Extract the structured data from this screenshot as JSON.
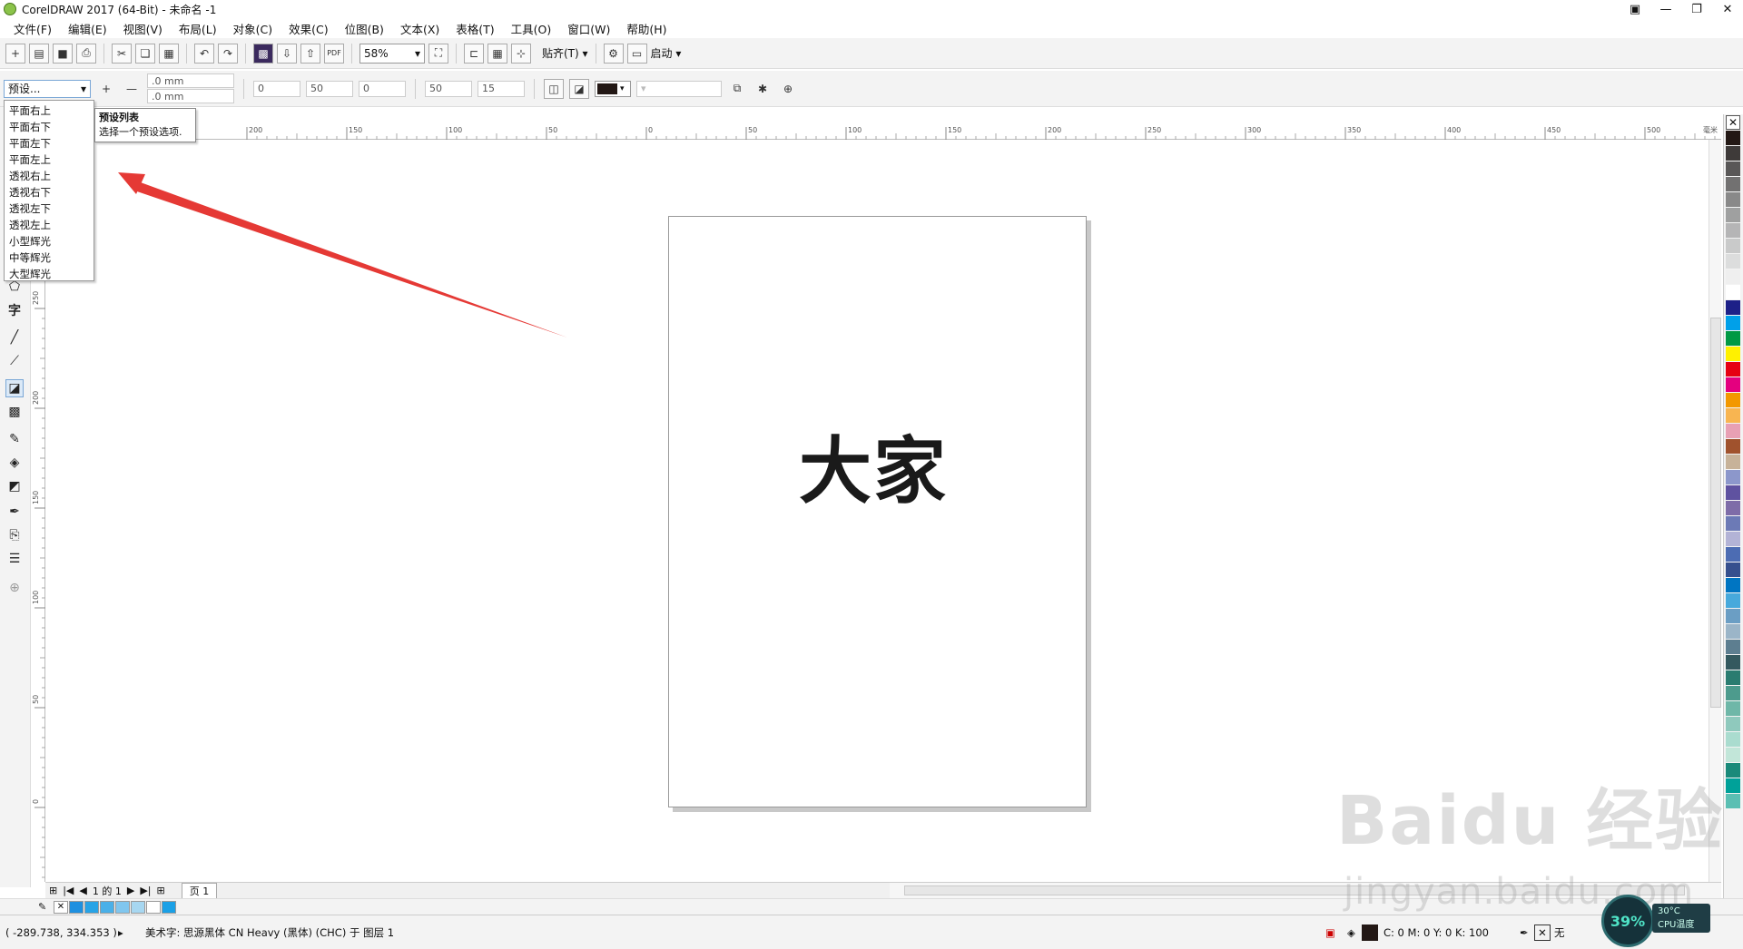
{
  "window": {
    "title": "CorelDRAW 2017 (64-Bit) - 未命名 -1"
  },
  "menu": [
    "文件(F)",
    "编辑(E)",
    "视图(V)",
    "布局(L)",
    "对象(C)",
    "效果(C)",
    "位图(B)",
    "文本(X)",
    "表格(T)",
    "工具(O)",
    "窗口(W)",
    "帮助(H)"
  ],
  "toolbar": {
    "zoom": "58%",
    "snap_label": "贴齐(T)",
    "launch_label": "启动"
  },
  "property_bar": {
    "preset_value": "预设...",
    "offset_x": ".0 mm",
    "offset_y": ".0 mm",
    "field_a": "0",
    "field_b": "50",
    "field_c": "0",
    "field_d": "50",
    "field_e": "15"
  },
  "preset_dropdown": {
    "items": [
      "平面右上",
      "平面右下",
      "平面左下",
      "平面左上",
      "透视右上",
      "透视右下",
      "透视左下",
      "透视左上",
      "小型辉光",
      "中等辉光",
      "大型辉光"
    ]
  },
  "tooltip": {
    "title": "预设列表",
    "desc": "选择一个预设选项."
  },
  "ruler": {
    "h_ticks": [
      "200",
      "150",
      "100",
      "50",
      "0",
      "50",
      "100",
      "150",
      "200",
      "250",
      "300",
      "350",
      "400",
      "450",
      "500"
    ],
    "h_unit": "毫米",
    "v_ticks": [
      "250",
      "200",
      "150",
      "100",
      "50",
      "0"
    ]
  },
  "canvas": {
    "text": "大家"
  },
  "page_nav": {
    "counter": "1 的 1",
    "tab": "页 1"
  },
  "status": {
    "coords": "( -289.738, 334.353 )",
    "object_info": "美术字: 思源黑体 CN Heavy (黑体) (CHC) 于 图层 1",
    "fill_info": "C: 0 M: 0 Y: 0 K: 100",
    "outline_info": "无"
  },
  "watermark": {
    "line1": "Baidu 经验",
    "line2": "jingyan.baidu.com"
  },
  "cpu_widget": {
    "percent": "39%",
    "temp": "30°C",
    "label": "CPU温度"
  },
  "colors": {
    "accent": "#7aa7d6",
    "arrow": "#e53935",
    "palette": [
      "#231815",
      "#3e3a39",
      "#595757",
      "#727171",
      "#898989",
      "#9fa0a0",
      "#b5b5b6",
      "#c9caca",
      "#dcdddd",
      "#efefef",
      "#ffffff",
      "#1d2088",
      "#00a0e9",
      "#009944",
      "#fff100",
      "#e60012",
      "#e4007f",
      "#f39800",
      "#f8b551",
      "#e8a0b4",
      "#a0522d",
      "#c7b299",
      "#8c97cb",
      "#5f52a0",
      "#7e6ca8",
      "#6c7ab6",
      "#b3b3d6",
      "#4c6cb3",
      "#36508e",
      "#0075c2",
      "#47a9dc",
      "#6b9ec4",
      "#9bb5c8",
      "#5d7e90",
      "#34595f",
      "#2a7c70",
      "#4d9b8d",
      "#6fb7a8",
      "#8fc9bd",
      "#aadccf",
      "#c2e6d9",
      "#1a8a7a",
      "#00a199",
      "#5bbfb3"
    ],
    "doc_palette": [
      "#1e90e0",
      "#27a3e6",
      "#4ab0e8",
      "#80c6ee",
      "#a7d7f1",
      "#ffffff",
      "#1aa0e6"
    ]
  }
}
